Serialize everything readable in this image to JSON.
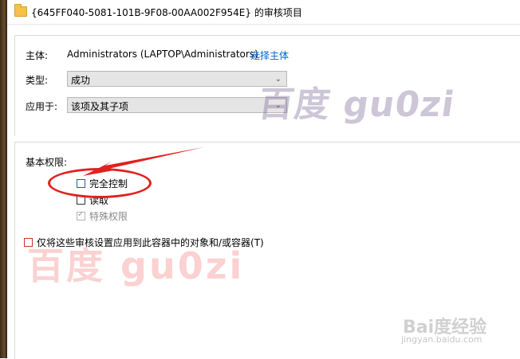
{
  "window": {
    "title": "{645FF040-5081-101B-9F08-00AA002F954E} 的审核项目"
  },
  "principal": {
    "label": "主体:",
    "value": "Administrators (LAPTOP\\Administrators)",
    "select_link": "选择主体"
  },
  "type": {
    "label": "类型:",
    "selected": "成功"
  },
  "applies_to": {
    "label": "应用于:",
    "selected": "该项及其子项"
  },
  "permissions": {
    "section_title": "基本权限:",
    "items": [
      {
        "label": "完全控制",
        "checked": false,
        "enabled": true
      },
      {
        "label": "读取",
        "checked": false,
        "enabled": true
      },
      {
        "label": "特殊权限",
        "checked": true,
        "enabled": false
      }
    ],
    "inherit_only_label": "仅将这些审核设置应用到此容器中的对象和/或容器(T)"
  },
  "watermarks": {
    "top": "百度 gu0zi",
    "middle": "百度 gu0zi",
    "logo": "Bai度经验",
    "url": "jingyan.baidu.com"
  },
  "colors": {
    "link": "#0066cc",
    "annotation": "#e0211f",
    "combo_bg": "#e5e5e5"
  }
}
